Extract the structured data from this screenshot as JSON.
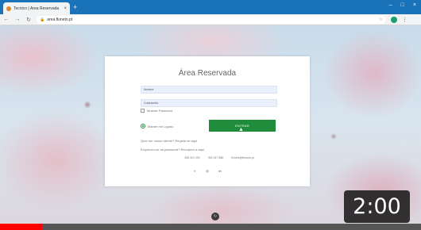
{
  "browser": {
    "tab_title": "Tecnico | Área Reservada",
    "tab_close": "×",
    "new_tab": "+",
    "window_controls": [
      "–",
      "□",
      "×"
    ],
    "nav": {
      "back": "←",
      "forward": "→",
      "reload": "↻"
    },
    "url": "area.fluneto.pt",
    "lock_icon": "🔒",
    "star_icon": "☆",
    "menu_icon": "⋮"
  },
  "login": {
    "title": "Área Reservada",
    "username_placeholder": "Nombre",
    "password_placeholder": "Contraseña",
    "show_password_label": "Mostrar Password",
    "remember_label": "Manter me Ligado",
    "enter_button": "ENTRAR",
    "register_link": "Quer ser nosso cliente? Registe-se aqui",
    "forgot_link": "Esqueceu-se da password? Recupere-a aqui",
    "contacts": [
      "258 321 291",
      "963 247 888",
      "fluneto@fluneto.pt"
    ],
    "social": [
      "f",
      "◎",
      "in"
    ]
  },
  "bottom_icon": "↻",
  "video": {
    "duration": "2:00",
    "progress": 0.1,
    "progress_color": "#ff0000"
  }
}
